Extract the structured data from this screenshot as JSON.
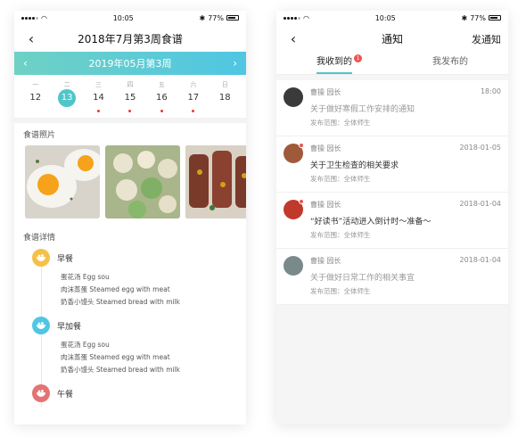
{
  "status": {
    "time": "10:05",
    "battery": "77%"
  },
  "left": {
    "title": "2018年7月第3周食谱",
    "week_label": "2019年05月第3周",
    "weekdays": [
      "一",
      "二",
      "三",
      "四",
      "五",
      "六",
      "日"
    ],
    "days": [
      {
        "num": "12",
        "selected": false,
        "dot": false
      },
      {
        "num": "13",
        "selected": true,
        "dot": false
      },
      {
        "num": "14",
        "selected": false,
        "dot": true
      },
      {
        "num": "15",
        "selected": false,
        "dot": true
      },
      {
        "num": "16",
        "selected": false,
        "dot": true
      },
      {
        "num": "17",
        "selected": false,
        "dot": true
      },
      {
        "num": "18",
        "selected": false,
        "dot": false
      }
    ],
    "photos_title": "食谱照片",
    "details_title": "食谱详情",
    "meals": [
      {
        "name": "早餐",
        "color": "#f5c04a",
        "items": [
          "蛋花汤  Egg sou",
          "肉沫蒸蛋  Steamed egg with meat",
          "奶香小馒头  Steamed bread with milk"
        ]
      },
      {
        "name": "早加餐",
        "color": "#4fc6e3",
        "items": [
          "蛋花汤  Egg sou",
          "肉沫蒸蛋  Steamed egg with meat",
          "奶香小馒头  Steamed bread with milk"
        ]
      },
      {
        "name": "午餐",
        "color": "#e57373",
        "items": []
      }
    ]
  },
  "right": {
    "title": "通知",
    "action": "发通知",
    "tabs": [
      {
        "label": "我收到的",
        "badge": "1"
      },
      {
        "label": "我发布的",
        "badge": ""
      }
    ],
    "notices": [
      {
        "sender": "曹操  园长",
        "date": "18:00",
        "title": "关于做好寒假工作安排的通知",
        "meta": "发布范围：全体师生",
        "unread": false,
        "title_color": "#999",
        "avatar": "#3a3a3a"
      },
      {
        "sender": "曹操  园长",
        "date": "2018-01-05",
        "title": "关于卫生检查的相关要求",
        "meta": "发布范围：全体师生",
        "unread": true,
        "title_color": "#333",
        "avatar": "#a05a3a"
      },
      {
        "sender": "曹操  园长",
        "date": "2018-01-04",
        "title": "“好读书”活动进入倒计时～准备～",
        "meta": "发布范围：全体师生",
        "unread": true,
        "title_color": "#333",
        "avatar": "#c0392b"
      },
      {
        "sender": "曹操  园长",
        "date": "2018-01-04",
        "title": "关于做好日常工作的相关事宜",
        "meta": "发布范围：全体师生",
        "unread": false,
        "title_color": "#999",
        "avatar": "#7a8a8a"
      }
    ]
  }
}
